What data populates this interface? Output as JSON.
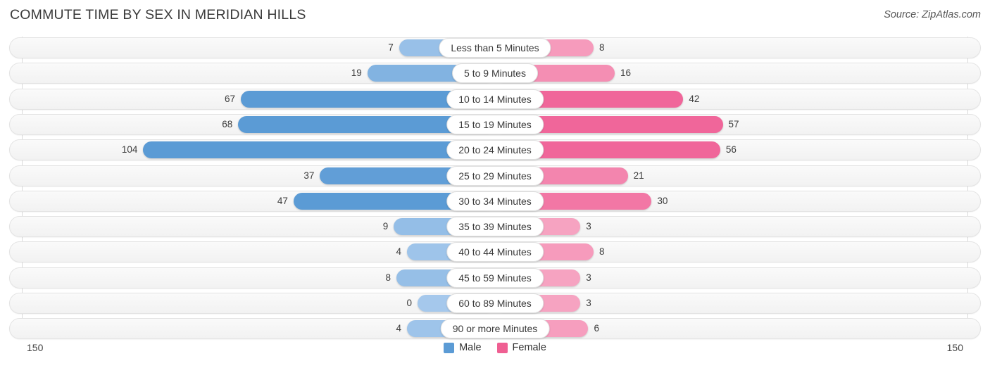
{
  "header": {
    "title": "COMMUTE TIME BY SEX IN MERIDIAN HILLS",
    "source": "Source: ZipAtlas.com"
  },
  "axis": {
    "left_label": "150",
    "right_label": "150"
  },
  "legend": {
    "items": [
      {
        "label": "Male",
        "color": "#5b9bd5"
      },
      {
        "label": "Female",
        "color": "#ef5f92"
      }
    ]
  },
  "colors": {
    "male_strong": "#5b9bd5",
    "male_light": "#a5c8ec",
    "female_strong": "#f0669a",
    "female_light": "#f7a8c4",
    "track": "#f6f6f6",
    "track_border": "#e3e3e3"
  },
  "chart_data": {
    "type": "bar",
    "orientation": "horizontal-diverging",
    "title": "COMMUTE TIME BY SEX IN MERIDIAN HILLS",
    "xlabel": "",
    "ylabel": "",
    "xlim": [
      150,
      150
    ],
    "grid": false,
    "legend_position": "bottom-center",
    "categories": [
      "Less than 5 Minutes",
      "5 to 9 Minutes",
      "10 to 14 Minutes",
      "15 to 19 Minutes",
      "20 to 24 Minutes",
      "25 to 29 Minutes",
      "30 to 34 Minutes",
      "35 to 39 Minutes",
      "40 to 44 Minutes",
      "45 to 59 Minutes",
      "60 to 89 Minutes",
      "90 or more Minutes"
    ],
    "series": [
      {
        "name": "Male",
        "color": "#5b9bd5",
        "values": [
          7,
          19,
          67,
          68,
          104,
          37,
          47,
          9,
          4,
          8,
          0,
          4
        ]
      },
      {
        "name": "Female",
        "color": "#ef5f92",
        "values": [
          8,
          16,
          42,
          57,
          56,
          21,
          30,
          3,
          8,
          3,
          3,
          6
        ]
      }
    ]
  }
}
